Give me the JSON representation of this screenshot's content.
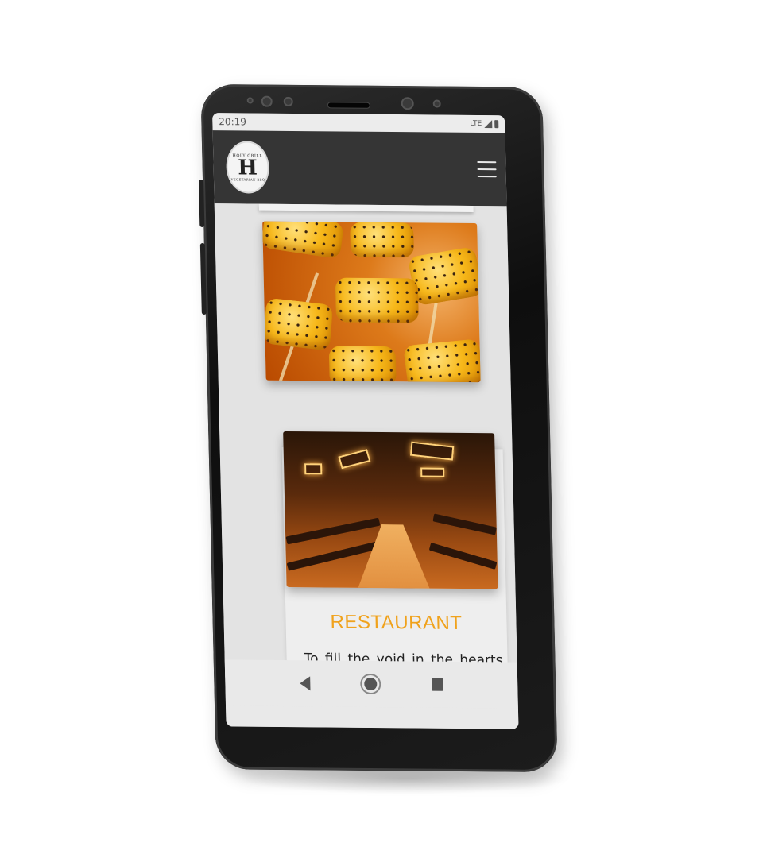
{
  "status_bar": {
    "time": "20:19",
    "network": "LTE"
  },
  "header": {
    "logo": {
      "top_text": "HOLY GRILL",
      "letter": "H",
      "bottom_text": "VEGETARIAN BBQ"
    },
    "menu_icon": "hamburger-menu-icon"
  },
  "content": {
    "images": [
      {
        "name": "grilled-corn-photo",
        "description_icon": "image"
      },
      {
        "name": "restaurant-interior-photo",
        "description_icon": "image"
      }
    ],
    "restaurant_section": {
      "title": "RESTAURANT",
      "text": "To fill the void in the hearts and the stomachs of the city's"
    }
  },
  "nav_bar": {
    "back_icon": "back-triangle-icon",
    "home_icon": "home-circle-icon",
    "recent_icon": "recent-apps-square-icon"
  },
  "colors": {
    "accent": "#f0a21c",
    "header_bg": "#353535",
    "content_bg": "#e3e3e3"
  }
}
